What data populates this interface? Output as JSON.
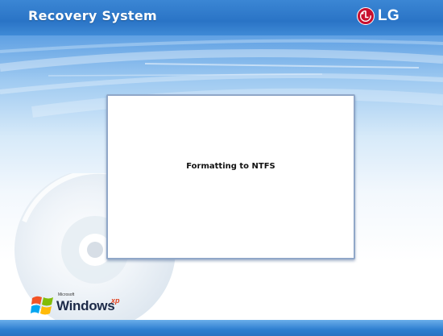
{
  "header": {
    "title": "Recovery System",
    "brand": "LG",
    "brand_icon": "lg-logo-icon"
  },
  "dialog": {
    "status_text": "Formatting to NTFS"
  },
  "os_logo": {
    "small_text": "Microsoft",
    "name": "Windows",
    "edition": "xp"
  },
  "colors": {
    "header_blue": "#2f7ccb",
    "lg_red": "#c8102e",
    "panel_border": "#90a7c8"
  }
}
